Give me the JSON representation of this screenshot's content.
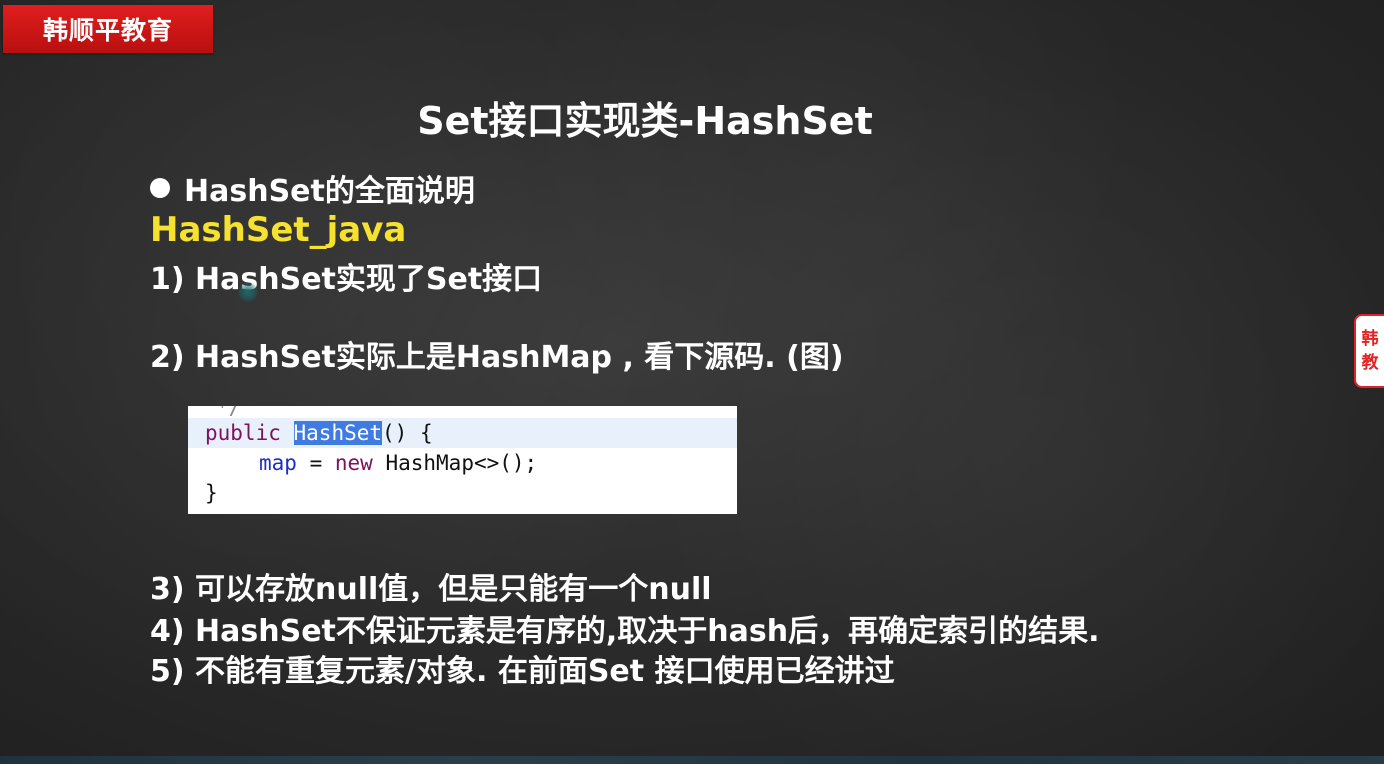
{
  "brand": {
    "text": "韩顺平教育"
  },
  "side_tab": {
    "line1": "韩",
    "line2": "教"
  },
  "slide": {
    "title": "Set接口实现类-HashSet",
    "bullet": "HashSet的全面说明",
    "file_label": "HashSet_java",
    "points": [
      "1) HashSet实现了Set接口",
      "2) HashSet实际上是HashMap , 看下源码. (图)",
      "3) 可以存放null值，但是只能有一个null",
      "4) HashSet不保证元素是有序的,取决于hash后，再确定索引的结果.",
      "5) 不能有重复元素/对象. 在前面Set 接口使用已经讲过"
    ]
  },
  "code": {
    "top_fragment": "*/",
    "l1_kw": "public",
    "l1_sel": "HashSet",
    "l1_rest": "() {",
    "l2_field": "map",
    "l2_eq": " = ",
    "l2_kw": "new",
    "l2_rest": " HashMap<>();",
    "l3": "}"
  }
}
